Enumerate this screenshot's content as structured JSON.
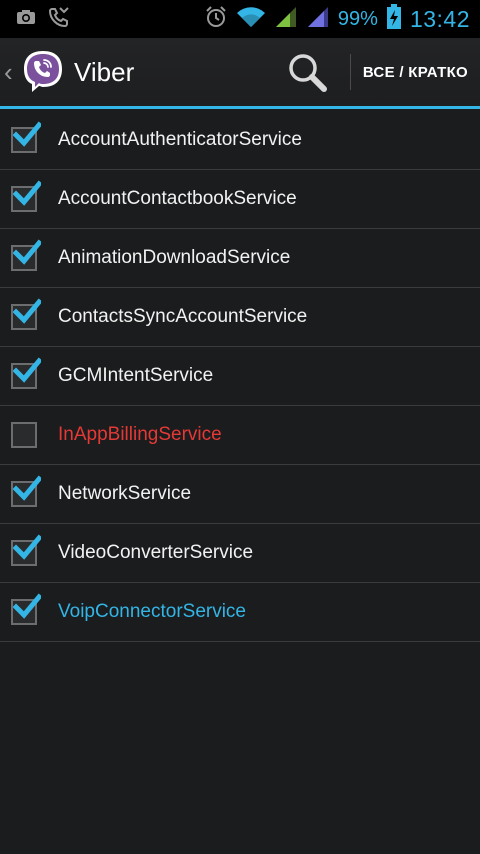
{
  "status_bar": {
    "icons_left": [
      "camera-icon",
      "missed-call-icon"
    ],
    "icons_right": [
      "alarm-icon",
      "wifi-icon",
      "signal-icon",
      "signal-icon-2",
      "battery-charging-icon"
    ],
    "battery": "99%",
    "time": "13:42"
  },
  "action_bar": {
    "up_icon": "back-caret-icon",
    "app_icon": "viber-logo",
    "title": "Viber",
    "search_icon": "search-icon",
    "mode_button": "ВСЕ / КРАТКО"
  },
  "colors": {
    "accent": "#33b5e5",
    "disabled": "#e53935",
    "text": "#f2f2f2",
    "viber_purple": "#7b519d"
  },
  "services": [
    {
      "name": "AccountAuthenticatorService",
      "checked": true,
      "state": "normal"
    },
    {
      "name": "AccountContactbookService",
      "checked": true,
      "state": "normal"
    },
    {
      "name": "AnimationDownloadService",
      "checked": true,
      "state": "normal"
    },
    {
      "name": "ContactsSyncAccountService",
      "checked": true,
      "state": "normal"
    },
    {
      "name": "GCMIntentService",
      "checked": true,
      "state": "normal"
    },
    {
      "name": "InAppBillingService",
      "checked": false,
      "state": "disabled"
    },
    {
      "name": "NetworkService",
      "checked": true,
      "state": "normal"
    },
    {
      "name": "VideoConverterService",
      "checked": true,
      "state": "normal"
    },
    {
      "name": "VoipConnectorService",
      "checked": true,
      "state": "running"
    }
  ]
}
